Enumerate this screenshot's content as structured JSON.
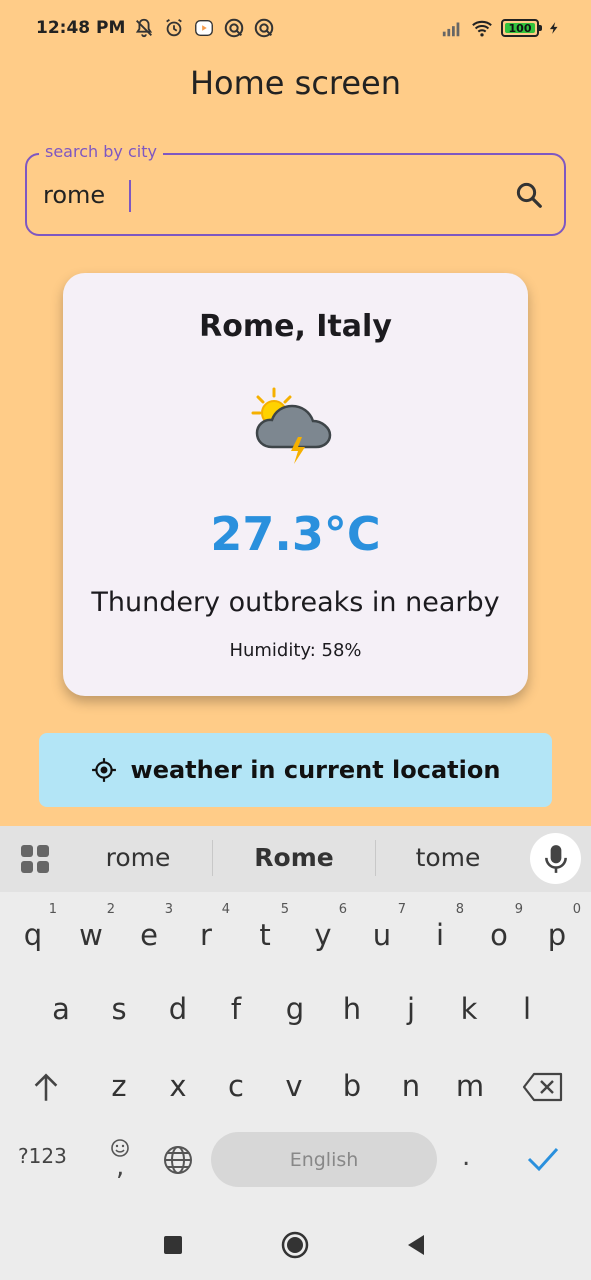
{
  "status_bar": {
    "time": "12:48 PM",
    "battery": "100",
    "icons": [
      "muted-bell-icon",
      "alarm-icon",
      "media-icon",
      "sync-icon",
      "sync-icon",
      "signal-icon",
      "wifi-icon",
      "battery-icon",
      "charging-icon"
    ]
  },
  "app_bar": {
    "title": "Home screen"
  },
  "search": {
    "label": "search by city",
    "value": "rome",
    "placeholder": "",
    "accent": "#7E57C2",
    "icon": "search-icon"
  },
  "weather_card": {
    "city": "Rome, Italy",
    "icon": "thunderstorm-sun-icon",
    "temperature": "27.3°C",
    "condition": "Thundery outbreaks in nearby",
    "humidity": "Humidity: 58%",
    "temp_color": "#2a90dd"
  },
  "location_button": {
    "label": "weather in current location",
    "icon": "my-location-icon",
    "background": "#B3E5F6"
  },
  "keyboard": {
    "suggestions": [
      "rome",
      "Rome",
      "tome"
    ],
    "row1": [
      {
        "k": "q",
        "h": "1"
      },
      {
        "k": "w",
        "h": "2"
      },
      {
        "k": "e",
        "h": "3"
      },
      {
        "k": "r",
        "h": "4"
      },
      {
        "k": "t",
        "h": "5"
      },
      {
        "k": "y",
        "h": "6"
      },
      {
        "k": "u",
        "h": "7"
      },
      {
        "k": "i",
        "h": "8"
      },
      {
        "k": "o",
        "h": "9"
      },
      {
        "k": "p",
        "h": "0"
      }
    ],
    "row2": [
      "a",
      "s",
      "d",
      "f",
      "g",
      "h",
      "j",
      "k",
      "l"
    ],
    "row3": [
      "z",
      "x",
      "c",
      "v",
      "b",
      "n",
      "m"
    ],
    "symbols_label": "?123",
    "space_label": "English",
    "period_label": ".",
    "emoji_comma": ","
  },
  "background": "#FFCC88"
}
